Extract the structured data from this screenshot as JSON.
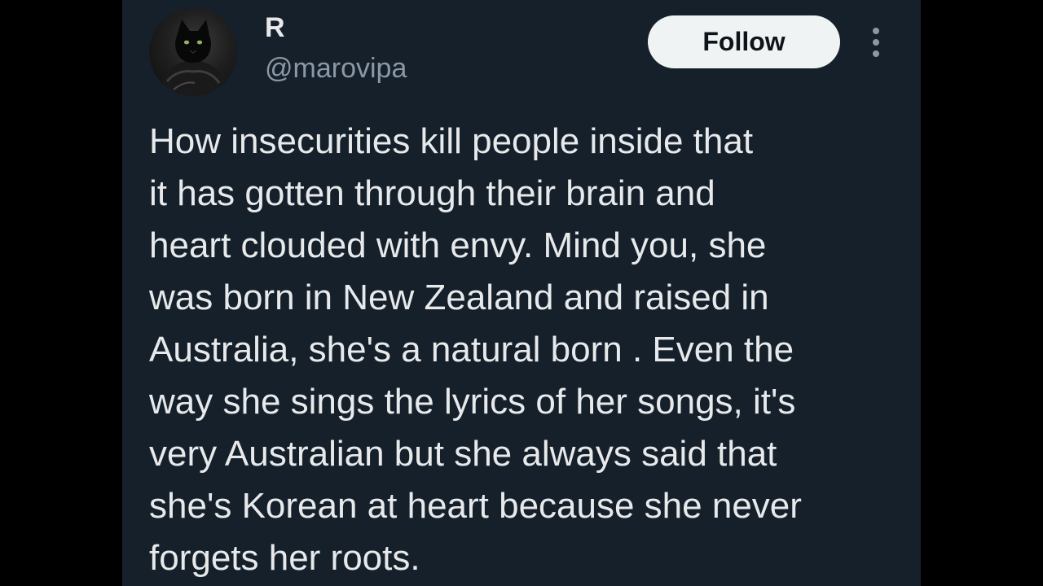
{
  "author": {
    "display_name": "R",
    "handle": "@marovipa",
    "avatar_icon": "black-cat-avatar"
  },
  "actions": {
    "follow_label": "Follow",
    "more_icon": "more-options-icon"
  },
  "tweet": {
    "text": "How insecurities kill people inside that\nit has gotten through their brain and\nheart clouded with envy. Mind you, she\nwas born in New Zealand and raised in\nAustralia, she's a natural born . Even the\nway she sings the lyrics of her songs, it's\nvery Australian but she always said that\nshe's Korean at heart because she never\nforgets her roots."
  },
  "colors": {
    "background": "#15202b",
    "text_primary": "#e7e9ea",
    "text_secondary": "#8b98a5",
    "follow_bg": "#eff3f4"
  }
}
